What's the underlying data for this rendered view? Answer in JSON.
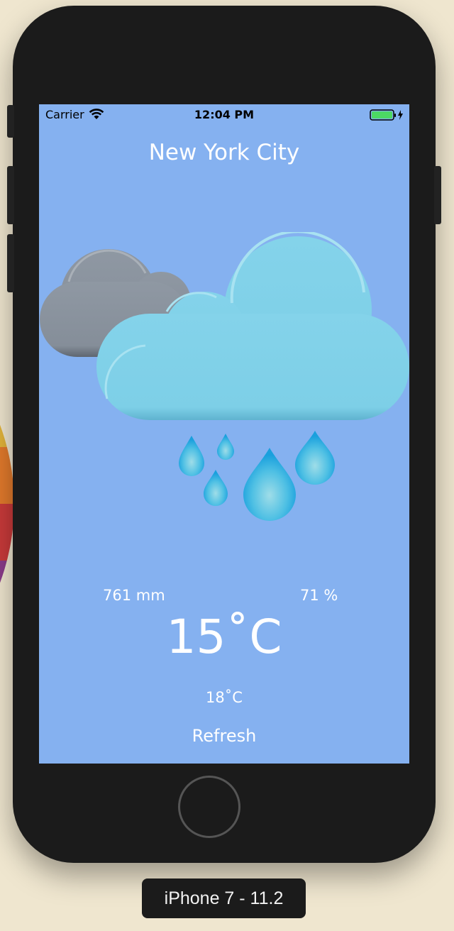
{
  "status_bar": {
    "carrier": "Carrier",
    "time": "12:04 PM",
    "wifi_icon": "wifi-icon",
    "battery_icon": "battery-charging-icon"
  },
  "weather": {
    "city": "New York City",
    "condition_icon": "rain-cloud-icon",
    "pressure": "761 mm",
    "humidity": "71 %",
    "temperature": "15˚C",
    "feels_like": "18˚C",
    "refresh_label": "Refresh"
  },
  "device": {
    "label": "iPhone 7 - 11.2"
  },
  "colors": {
    "screen_background": "#85b1f0",
    "device_body": "#1b1b1b",
    "text": "#ffffff",
    "battery": "#4cd964"
  }
}
